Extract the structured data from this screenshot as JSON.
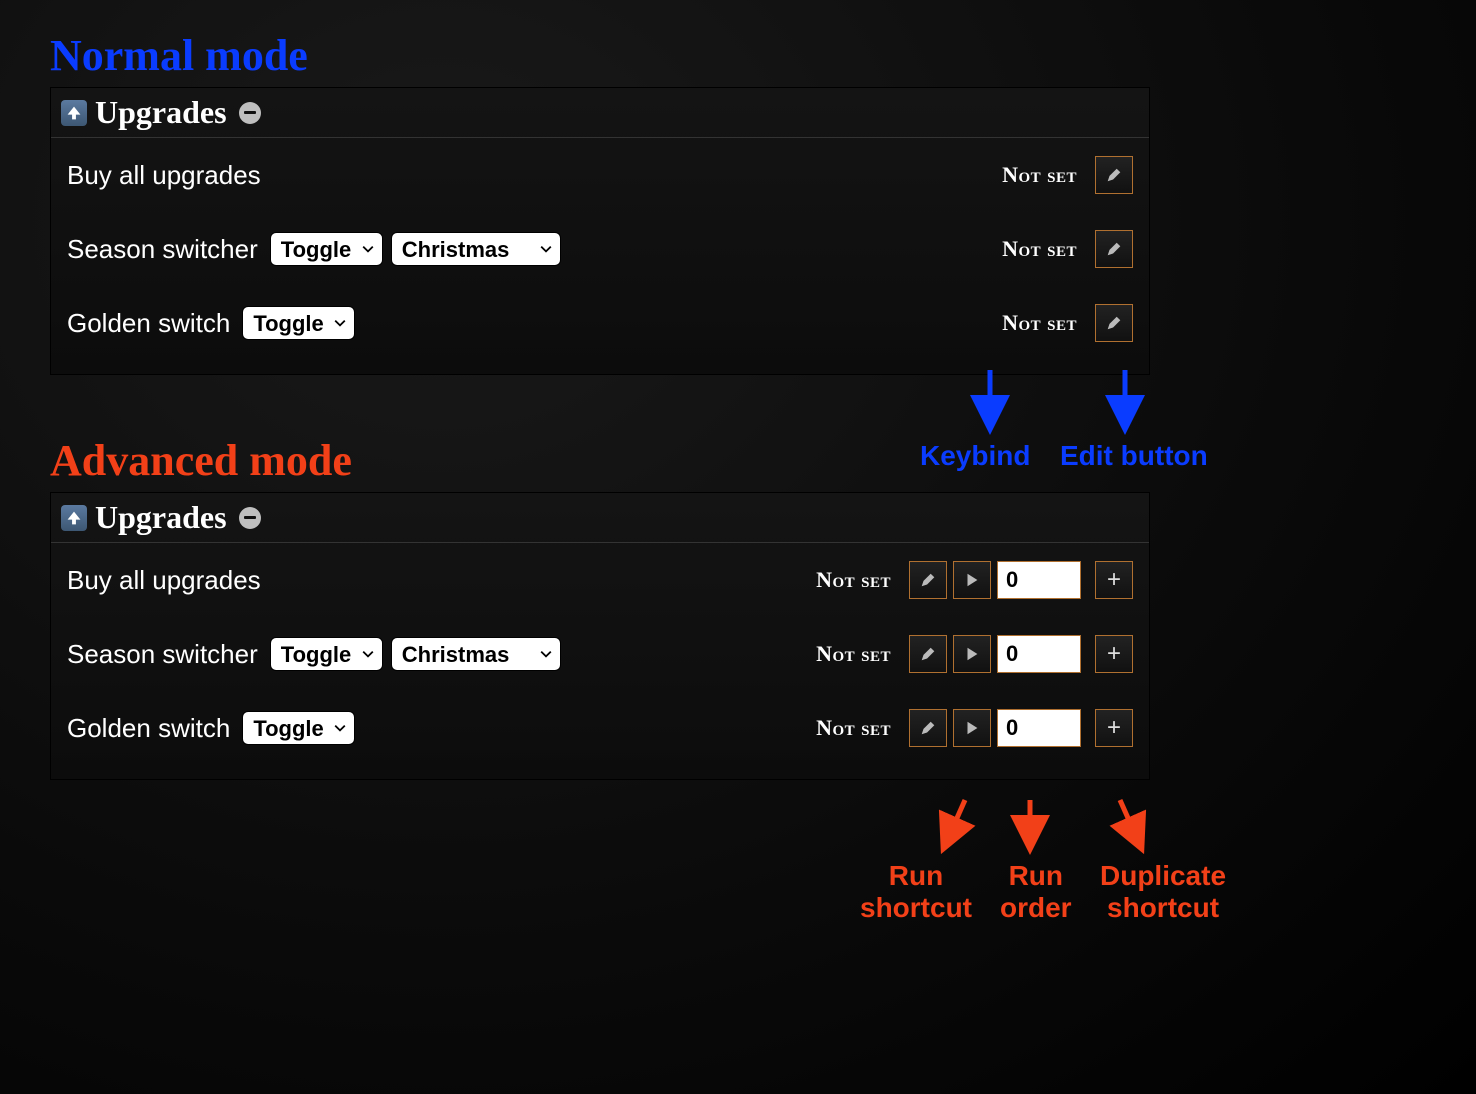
{
  "normal": {
    "heading": "Normal mode",
    "section_title": "Upgrades",
    "rows": [
      {
        "label": "Buy all upgrades",
        "keybind": "Not set"
      },
      {
        "label": "Season switcher",
        "sel1": "Toggle",
        "sel2": "Christmas",
        "keybind": "Not set"
      },
      {
        "label": "Golden switch",
        "sel1": "Toggle",
        "keybind": "Not set"
      }
    ]
  },
  "advanced": {
    "heading": "Advanced mode",
    "section_title": "Upgrades",
    "rows": [
      {
        "label": "Buy all upgrades",
        "keybind": "Not set",
        "order": "0"
      },
      {
        "label": "Season switcher",
        "sel1": "Toggle",
        "sel2": "Christmas",
        "keybind": "Not set",
        "order": "0"
      },
      {
        "label": "Golden switch",
        "sel1": "Toggle",
        "keybind": "Not set",
        "order": "0"
      }
    ]
  },
  "annotations": {
    "keybind": "Keybind",
    "edit_button": "Edit button",
    "run_shortcut_l1": "Run",
    "run_shortcut_l2": "shortcut",
    "run_order_l1": "Run",
    "run_order_l2": "order",
    "duplicate_l1": "Duplicate",
    "duplicate_l2": "shortcut"
  }
}
